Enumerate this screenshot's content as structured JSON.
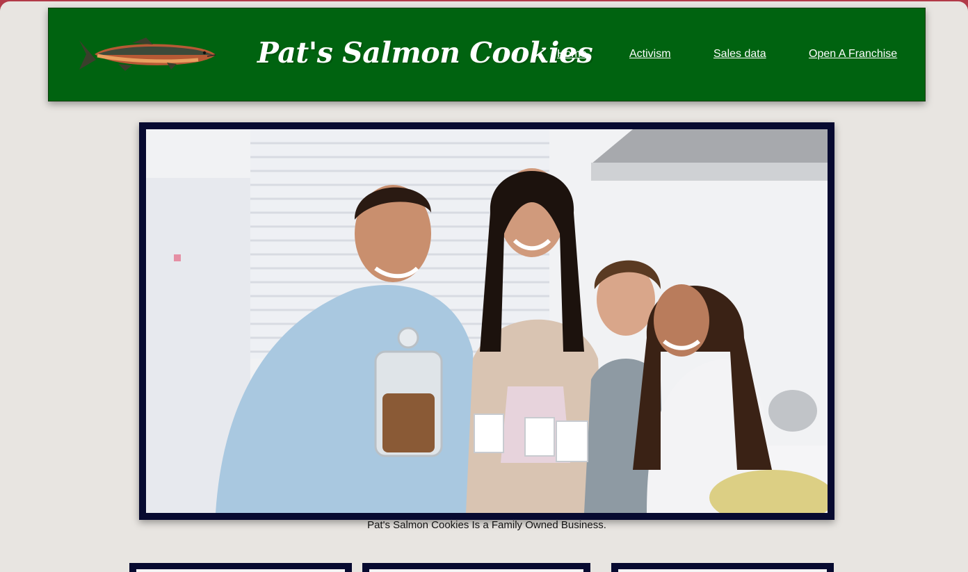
{
  "header": {
    "site_title": "Pat's Salmon Cookies",
    "logo_icon": "salmon-fish-icon"
  },
  "nav": {
    "items": [
      {
        "label": "Home"
      },
      {
        "label": "Activism"
      },
      {
        "label": "Sales data"
      },
      {
        "label": "Open A Franchise"
      }
    ]
  },
  "hero": {
    "image": "family-kitchen-photo",
    "caption": "Pat's Salmon Cookies Is a Family Owned Business."
  },
  "colors": {
    "header_bg": "#006310",
    "frame": "#070a30",
    "page_bg": "#e8e5e1"
  }
}
